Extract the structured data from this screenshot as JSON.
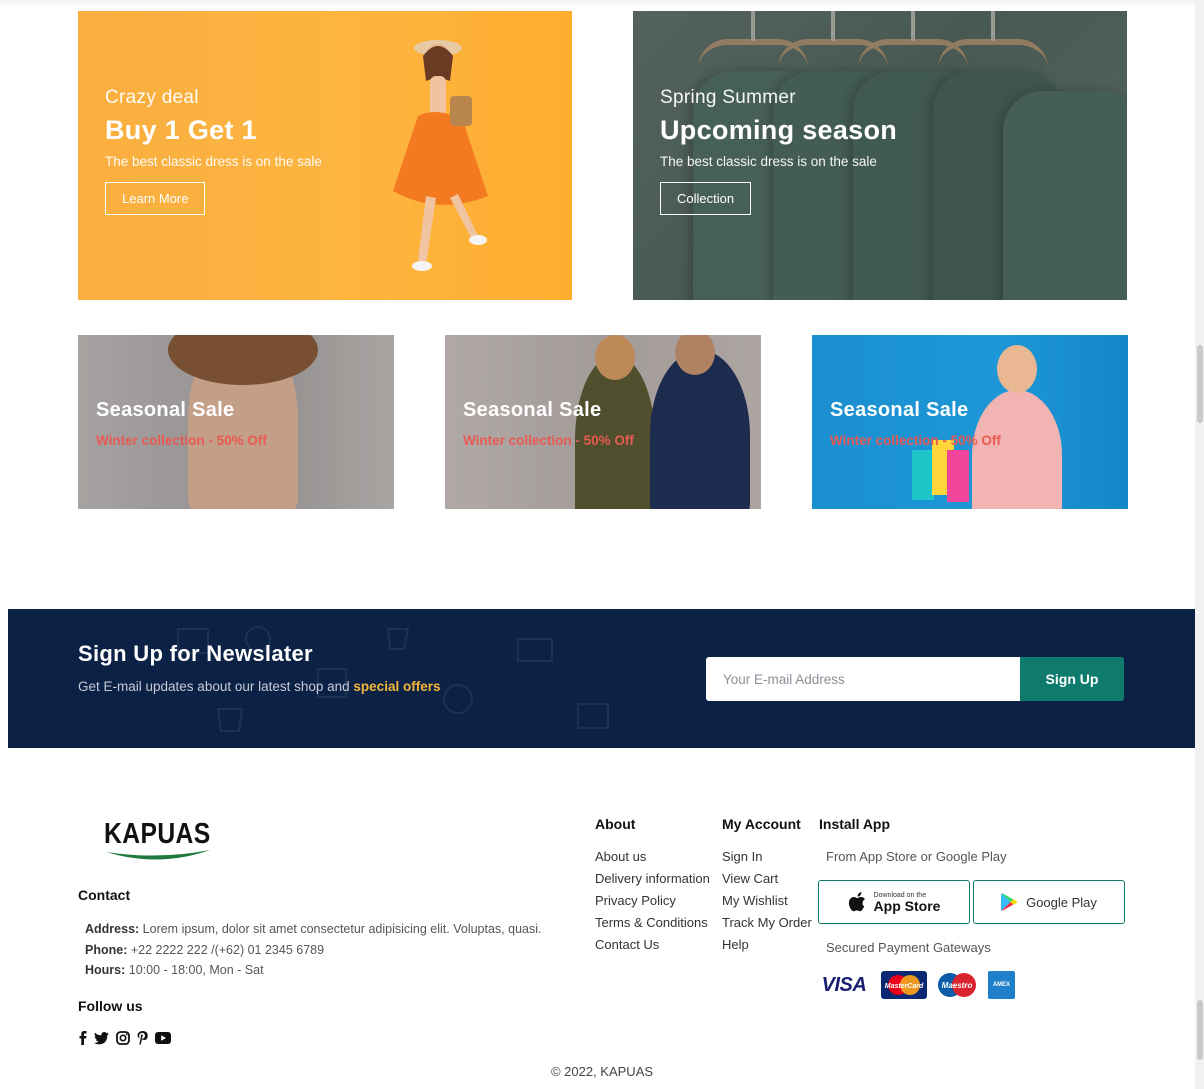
{
  "promo_big": [
    {
      "eyebrow": "Crazy deal",
      "headline": "Buy 1 Get 1",
      "subtitle": "The best classic dress is on the sale",
      "button_label": "Learn More"
    },
    {
      "eyebrow": "Spring Summer",
      "headline": "Upcoming season",
      "subtitle": "The best classic dress is on the sale",
      "button_label": "Collection"
    }
  ],
  "promo_small": [
    {
      "title": "Seasonal Sale",
      "offer": "Winter collection - 50% Off"
    },
    {
      "title": "Seasonal Sale",
      "offer": "Winter collection - 50% Off"
    },
    {
      "title": "Seasonal Sale",
      "offer": "Winter collection - 50% Off"
    }
  ],
  "newsletter": {
    "heading": "Sign Up for Newslater",
    "text_before": "Get E-mail updates about our latest shop and ",
    "highlight": "special offers",
    "placeholder": "Your E-mail Address",
    "button_label": "Sign Up"
  },
  "footer": {
    "brand": "KAPUAS",
    "contact_heading": "Contact",
    "address_label": "Address:",
    "address": " Lorem ipsum, dolor sit amet consectetur adipisicing elit. Voluptas, quasi.",
    "phone_label": "Phone:",
    "phone": " +22 2222 222 /(+62) 01 2345 6789",
    "hours_label": "Hours:",
    "hours": " 10:00 - 18:00, Mon - Sat",
    "follow_heading": "Follow us",
    "social_icons": [
      "facebook-icon",
      "twitter-icon",
      "instagram-icon",
      "pinterest-icon",
      "youtube-icon"
    ],
    "about": {
      "heading": "About",
      "links": [
        "About us",
        "Delivery information",
        "Privacy Policy",
        "Terms & Conditions",
        "Contact Us"
      ]
    },
    "account": {
      "heading": "My Account",
      "links": [
        "Sign In",
        "View Cart",
        "My Wishlist",
        "Track My Order",
        "Help"
      ]
    },
    "install": {
      "heading": "Install App",
      "subtitle": "From App Store or Google Play",
      "app_store_small": "Download on the",
      "app_store_big": "App Store",
      "google_play": "Google Play",
      "payment_heading": "Secured Payment Gateways",
      "payments": [
        "VISA",
        "MasterCard",
        "Maestro",
        "AMEX"
      ]
    },
    "copyright": "© 2022, KAPUAS"
  },
  "colors": {
    "accent": "#0f7b6c",
    "newsletter_bg": "#0b2246",
    "highlight": "#f5b63a",
    "offer_red": "#e85a54",
    "banner_orange": "#fdb540"
  }
}
